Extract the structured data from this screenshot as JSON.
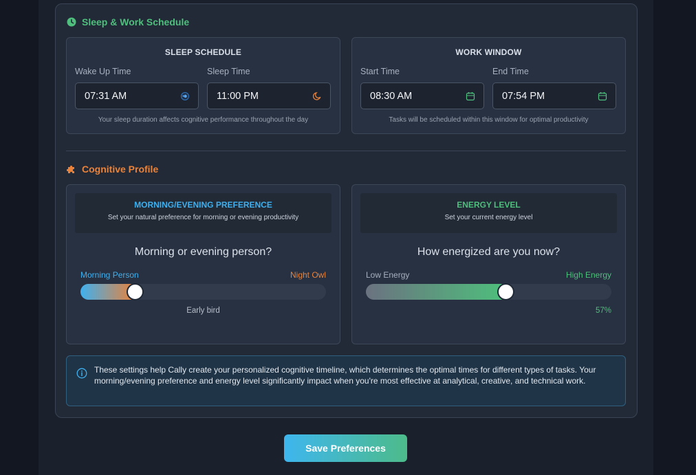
{
  "sleep_work": {
    "title": "Sleep & Work Schedule",
    "sleep_schedule": {
      "heading": "SLEEP SCHEDULE",
      "wake_label": "Wake Up Time",
      "wake_value": "07:31 AM",
      "sleep_label": "Sleep Time",
      "sleep_value": "11:00 PM",
      "hint": "Your sleep duration affects cognitive performance throughout the day"
    },
    "work_window": {
      "heading": "WORK WINDOW",
      "start_label": "Start Time",
      "start_value": "08:30 AM",
      "end_label": "End Time",
      "end_value": "07:54 PM",
      "hint": "Tasks will be scheduled within this window for optimal productivity"
    }
  },
  "cognitive": {
    "title": "Cognitive Profile",
    "preference": {
      "heading": "MORNING/EVENING PREFERENCE",
      "subheading": "Set your natural preference for morning or evening productivity",
      "question": "Morning or evening person?",
      "left_label": "Morning Person",
      "right_label": "Night Owl",
      "value": 0.22,
      "value_label": "Early bird"
    },
    "energy": {
      "heading": "ENERGY LEVEL",
      "subheading": "Set your current energy level",
      "question": "How energized are you now?",
      "left_label": "Low Energy",
      "right_label": "High Energy",
      "value": 0.57,
      "value_label": "57%"
    }
  },
  "info": {
    "text": "These settings help Cally create your personalized cognitive timeline, which determines the optimal times for different types of tasks. Your morning/evening preference and energy level significantly impact when you're most effective at analytical, creative, and technical work."
  },
  "actions": {
    "save_label": "Save Preferences"
  },
  "colors": {
    "green": "#4ebf7c",
    "orange": "#e9823a",
    "blue": "#3fb0ef"
  },
  "icons": {
    "schedule": "clock-icon",
    "cognitive": "puzzle-icon",
    "wake": "sun-icon",
    "sleep": "moon-icon",
    "start": "calendar-icon",
    "end": "calendar-icon",
    "info": "info-icon"
  }
}
